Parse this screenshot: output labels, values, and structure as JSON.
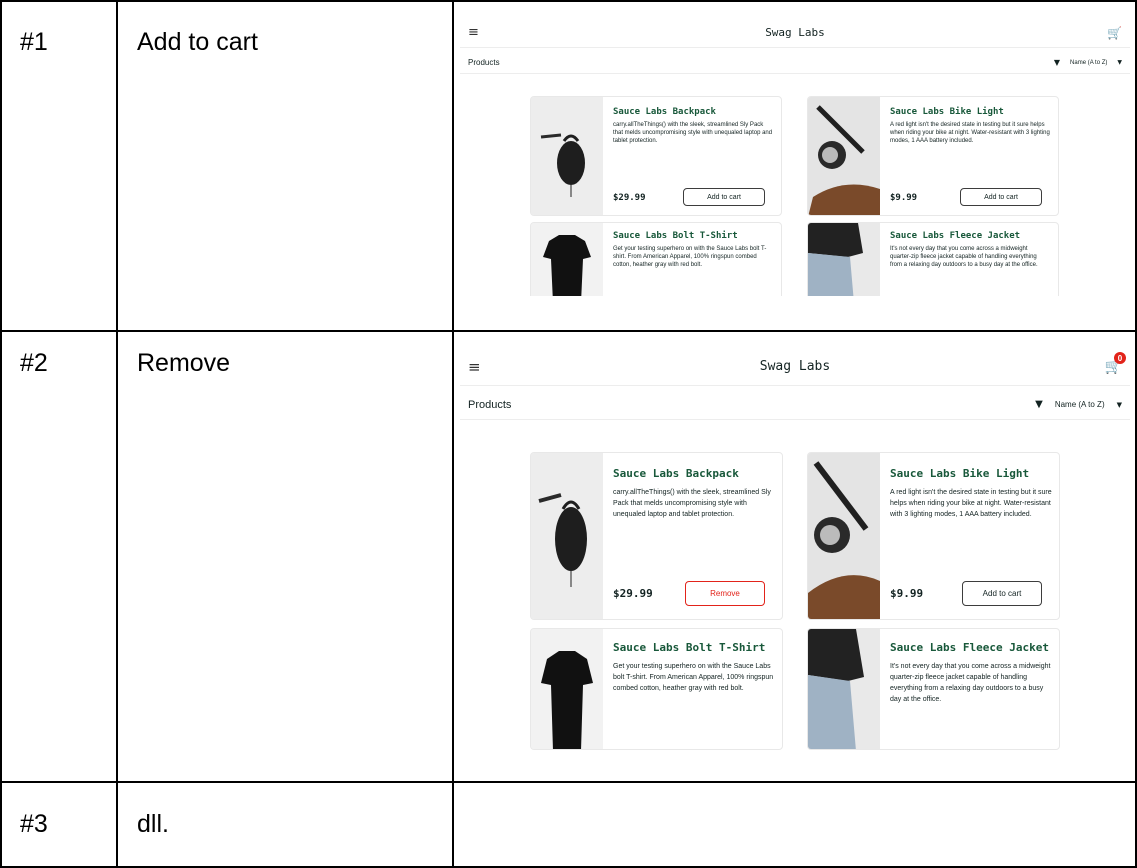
{
  "rows": [
    {
      "num": "#1",
      "label": "Add to cart"
    },
    {
      "num": "#2",
      "label": "Remove"
    },
    {
      "num": "#3",
      "label": "dll."
    }
  ],
  "app": {
    "title": "Swag Labs",
    "products_label": "Products",
    "sort_value": "Name (A to Z)",
    "cart_count": "0",
    "menu_icon": "hamburger-icon",
    "cart_icon": "cart-icon",
    "filter_icon": "filter-icon",
    "colors": {
      "name": "#18583a",
      "remove": "#e2231a",
      "badge": "#e2231a"
    }
  },
  "items": [
    {
      "name": "Sauce Labs Backpack",
      "desc": "carry.allTheThings() with the sleek, streamlined Sly Pack that melds uncompromising style with unequaled laptop and tablet protection.",
      "price": "$29.99"
    },
    {
      "name": "Sauce Labs Bike Light",
      "desc": "A red light isn't the desired state in testing but it sure helps when riding your bike at night. Water-resistant with 3 lighting modes, 1 AAA battery included.",
      "price": "$9.99"
    },
    {
      "name": "Sauce Labs Bolt T-Shirt",
      "desc": "Get your testing superhero on with the Sauce Labs bolt T-shirt. From American Apparel, 100% ringspun combed cotton, heather gray with red bolt."
    },
    {
      "name": "Sauce Labs Fleece Jacket",
      "desc": "It's not every day that you come across a midweight quarter-zip fleece jacket capable of handling everything from a relaxing day outdoors to a busy day at the office."
    }
  ],
  "shot1": {
    "backpack_button": "Add to cart",
    "bike_button": "Add to cart"
  },
  "shot2": {
    "backpack_button": "Remove",
    "bike_button": "Add to cart"
  }
}
